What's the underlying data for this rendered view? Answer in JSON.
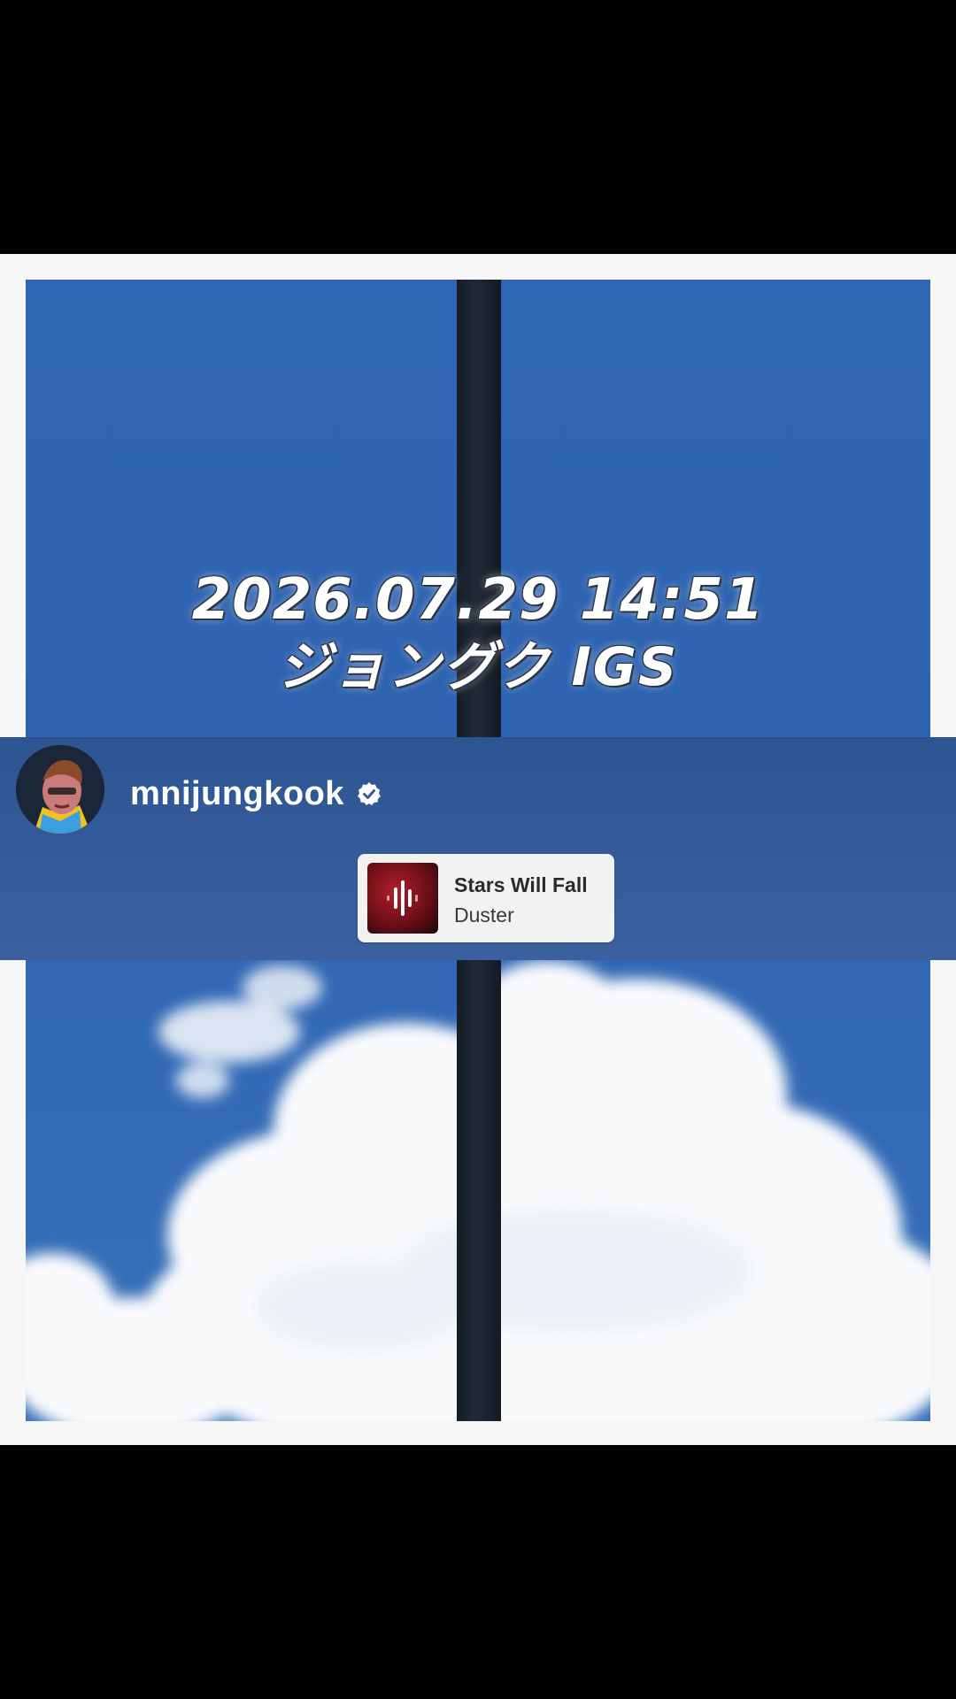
{
  "caption": {
    "datetime": "2026.07.29 14:51",
    "subtitle": "ジョングク IGS"
  },
  "post": {
    "username": "mnijungkook",
    "verified": true
  },
  "music_sticker": {
    "title": "Stars Will Fall",
    "artist": "Duster"
  },
  "icons": {
    "verified": "verified-badge-icon",
    "audio": "audio-waveform-icon"
  },
  "colors": {
    "sky": "#2f66b4",
    "band": "#345b98",
    "frame": "#f6f6f6",
    "sticker_bg": "#f2f2f2",
    "album_red": "#b01e2a"
  }
}
